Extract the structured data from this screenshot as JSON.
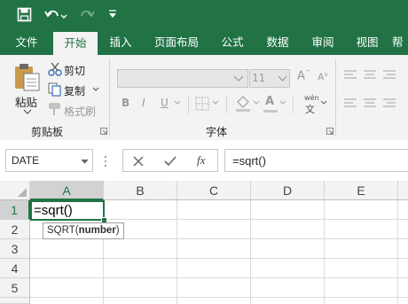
{
  "colors": {
    "brand": "#217346",
    "ribbon": "#f3f3f3",
    "selection": "#217346"
  },
  "quick_access": {
    "save_icon": "save-icon",
    "undo_icon": "undo-icon",
    "redo_icon": "redo-icon",
    "customize_icon": "customize-qat-icon"
  },
  "tabs": [
    {
      "label": "文件"
    },
    {
      "label": "开始"
    },
    {
      "label": "插入"
    },
    {
      "label": "页面布局"
    },
    {
      "label": "公式"
    },
    {
      "label": "数据"
    },
    {
      "label": "审阅"
    },
    {
      "label": "视图"
    },
    {
      "label": "帮"
    }
  ],
  "clipboard": {
    "paste_label": "粘贴",
    "cut_label": "剪切",
    "copy_label": "复制",
    "format_painter_label": "格式刷",
    "group_label": "剪贴板"
  },
  "font": {
    "name_value": "",
    "size_value": "11",
    "bold": "B",
    "italic": "I",
    "underline": "U",
    "phonetic": "wén",
    "group_label": "字体"
  },
  "formula_bar": {
    "name_box": "DATE",
    "fx": "fx",
    "formula": "=sqrt()"
  },
  "sheet": {
    "columns": [
      "A",
      "B",
      "C",
      "D",
      "E"
    ],
    "rows": [
      "1",
      "2",
      "3",
      "4",
      "5"
    ],
    "active_cell_text": "=sqrt()",
    "tooltip_func": "SQRT(",
    "tooltip_arg": "number",
    "tooltip_close": ")"
  }
}
